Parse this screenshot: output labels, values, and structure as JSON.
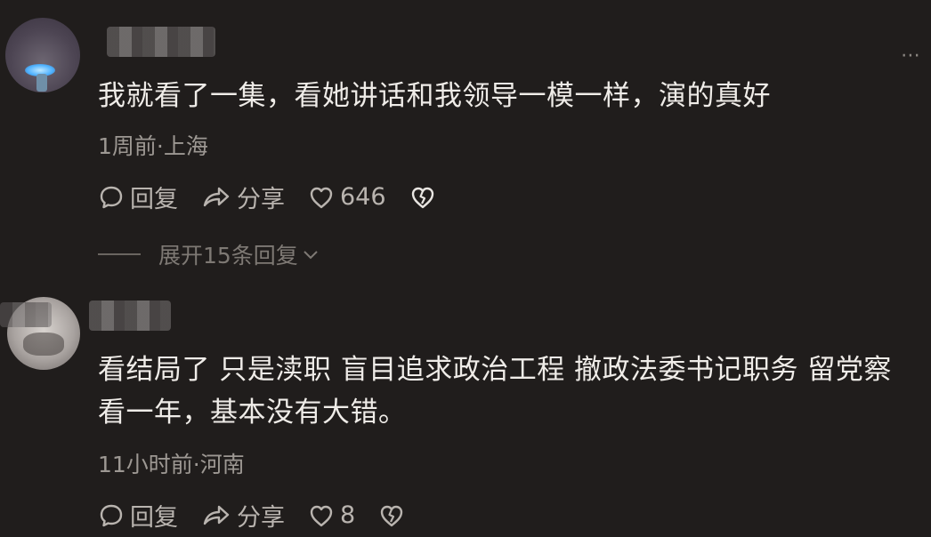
{
  "comments": [
    {
      "text": "我就看了一集，看她讲话和我领导一模一样，演的真好",
      "meta": "1周前·上海",
      "reply_label": "回复",
      "share_label": "分享",
      "like_count": "646",
      "expand_label": "展开15条回复"
    },
    {
      "text": "看结局了 只是渎职 盲目追求政治工程 撤政法委书记职务 留党察看一年，基本没有大错。",
      "meta": "11小时前·河南",
      "reply_label": "回复",
      "share_label": "分享",
      "like_count": "8"
    }
  ],
  "icons": {
    "more": "more-options-icon",
    "reply": "comment-bubble-icon",
    "share": "share-arrow-icon",
    "like": "heart-outline-icon",
    "dislike": "broken-heart-icon",
    "expand": "chevron-down-icon"
  },
  "colors": {
    "background": "#201d1c",
    "text": "#efece8",
    "meta": "#9d9893",
    "action": "#b9b4af"
  }
}
